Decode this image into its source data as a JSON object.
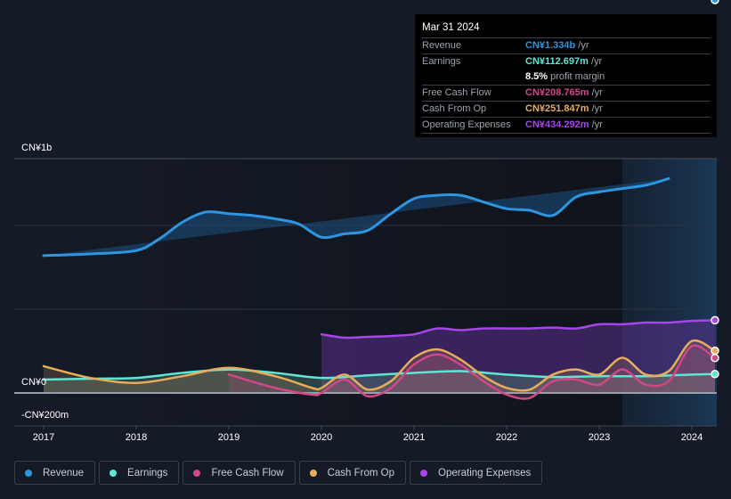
{
  "tooltip": {
    "date": "Mar 31 2024",
    "rows": [
      {
        "label": "Revenue",
        "value": "CN¥1.334b",
        "unit": "/yr",
        "color": "#2e95e0"
      },
      {
        "label": "Earnings",
        "value": "CN¥112.697m",
        "unit": "/yr",
        "color": "#5ee6d4"
      },
      {
        "label": "",
        "value": "8.5%",
        "unit": "profit margin",
        "color": "#ffffff"
      },
      {
        "label": "Free Cash Flow",
        "value": "CN¥208.765m",
        "unit": "/yr",
        "color": "#d0478a"
      },
      {
        "label": "Cash From Op",
        "value": "CN¥251.847m",
        "unit": "/yr",
        "color": "#e8ad5c"
      },
      {
        "label": "Operating Expenses",
        "value": "CN¥434.292m",
        "unit": "/yr",
        "color": "#a646e8"
      }
    ]
  },
  "legend": [
    {
      "label": "Revenue",
      "color": "#2e95e0"
    },
    {
      "label": "Earnings",
      "color": "#5ee6d4"
    },
    {
      "label": "Free Cash Flow",
      "color": "#d0478a"
    },
    {
      "label": "Cash From Op",
      "color": "#e8ad5c"
    },
    {
      "label": "Operating Expenses",
      "color": "#a646e8"
    }
  ],
  "chart_data": {
    "type": "area",
    "title": "",
    "xlabel": "",
    "ylabel": "",
    "ylim": [
      -0.2,
      1.4
    ],
    "y_unit": "CN¥ billions",
    "y_tick_labels": [
      {
        "value": 1.4,
        "label": "CN¥1b"
      },
      {
        "value": 0,
        "label": "CN¥0"
      },
      {
        "value": -0.2,
        "label": "-CN¥200m"
      }
    ],
    "gridlines": [
      0.5,
      1.0,
      1.4
    ],
    "x_range": [
      2016.9,
      2024.25
    ],
    "x_ticks": [
      2017,
      2018,
      2019,
      2020,
      2021,
      2022,
      2023,
      2024
    ],
    "highlight_start": 2023.25,
    "series": [
      {
        "name": "Revenue",
        "color": "#2e95e0",
        "x": [
          2017.0,
          2017.5,
          2018.0,
          2018.25,
          2018.5,
          2018.75,
          2019.0,
          2019.25,
          2019.5,
          2019.75,
          2020.0,
          2020.25,
          2020.5,
          2020.75,
          2021.0,
          2021.25,
          2021.5,
          2021.75,
          2022.0,
          2022.25,
          2022.5,
          2022.75,
          2023.0,
          2023.25,
          2023.5,
          2023.75,
          2024.0,
          2024.25
        ],
        "values": [
          0.82,
          0.83,
          0.85,
          0.92,
          1.02,
          1.08,
          1.07,
          1.06,
          1.04,
          1.01,
          0.93,
          0.95,
          0.97,
          1.07,
          1.16,
          1.18,
          1.18,
          1.14,
          1.1,
          1.09,
          1.06,
          1.17,
          1.2,
          1.22,
          1.24,
          1.28,
          1.334
        ]
      },
      {
        "name": "Earnings",
        "color": "#5ee6d4",
        "x": [
          2017.0,
          2017.5,
          2018.0,
          2018.5,
          2019.0,
          2019.5,
          2020.0,
          2020.5,
          2021.0,
          2021.5,
          2022.0,
          2022.5,
          2023.0,
          2023.5,
          2024.0,
          2024.25
        ],
        "values": [
          0.08,
          0.085,
          0.09,
          0.12,
          0.14,
          0.12,
          0.09,
          0.105,
          0.12,
          0.13,
          0.11,
          0.095,
          0.1,
          0.1,
          0.11,
          0.113
        ]
      },
      {
        "name": "Free Cash Flow",
        "color": "#d0478a",
        "x": [
          2019.0,
          2019.5,
          2019.9,
          2020.0,
          2020.25,
          2020.5,
          2020.75,
          2021.0,
          2021.25,
          2021.5,
          2021.75,
          2022.0,
          2022.25,
          2022.5,
          2022.75,
          2023.0,
          2023.25,
          2023.5,
          2023.75,
          2024.0,
          2024.25
        ],
        "values": [
          0.11,
          0.03,
          -0.01,
          0.0,
          0.08,
          -0.02,
          0.03,
          0.17,
          0.23,
          0.17,
          0.07,
          -0.01,
          -0.03,
          0.07,
          0.08,
          0.05,
          0.14,
          0.05,
          0.07,
          0.28,
          0.209
        ]
      },
      {
        "name": "Cash From Op",
        "color": "#e8ad5c",
        "x": [
          2017.0,
          2017.5,
          2018.0,
          2018.5,
          2019.0,
          2019.5,
          2019.9,
          2020.0,
          2020.25,
          2020.5,
          2020.75,
          2021.0,
          2021.25,
          2021.5,
          2021.75,
          2022.0,
          2022.25,
          2022.5,
          2022.75,
          2023.0,
          2023.25,
          2023.5,
          2023.75,
          2024.0,
          2024.25
        ],
        "values": [
          0.16,
          0.09,
          0.06,
          0.1,
          0.15,
          0.1,
          0.03,
          0.03,
          0.11,
          0.02,
          0.07,
          0.21,
          0.26,
          0.2,
          0.1,
          0.03,
          0.02,
          0.11,
          0.14,
          0.11,
          0.21,
          0.11,
          0.13,
          0.31,
          0.252
        ]
      },
      {
        "name": "Operating Expenses",
        "color": "#a646e8",
        "x": [
          2020.0,
          2020.25,
          2020.5,
          2020.75,
          2021.0,
          2021.25,
          2021.5,
          2021.75,
          2022.0,
          2022.25,
          2022.5,
          2022.75,
          2023.0,
          2023.25,
          2023.5,
          2023.75,
          2024.0,
          2024.25
        ],
        "values": [
          0.35,
          0.33,
          0.335,
          0.34,
          0.35,
          0.385,
          0.375,
          0.385,
          0.385,
          0.385,
          0.39,
          0.385,
          0.41,
          0.41,
          0.42,
          0.42,
          0.43,
          0.434
        ]
      }
    ]
  }
}
